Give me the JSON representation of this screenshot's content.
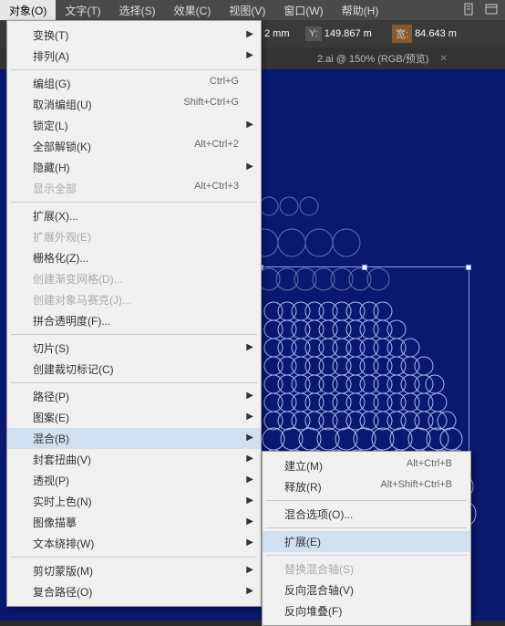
{
  "menubar": {
    "items": [
      "对象(O)",
      "文字(T)",
      "选择(S)",
      "效果(C)",
      "视图(V)",
      "窗口(W)",
      "帮助(H)"
    ],
    "active_index": 0
  },
  "propbar": {
    "unit1": "2 mm",
    "y_label": "Y:",
    "y_value": "149.867 m",
    "w_label": "宽:",
    "w_value": "84.643 m"
  },
  "tabbar": {
    "tabs": [
      {
        "label": ""
      },
      {
        "label": "2.ai @ 150% (RGB/预览)"
      }
    ]
  },
  "object_menu": [
    {
      "label": "变换(T)",
      "sub": true
    },
    {
      "label": "排列(A)",
      "sub": true
    },
    {
      "sep": true
    },
    {
      "label": "编组(G)",
      "shortcut": "Ctrl+G"
    },
    {
      "label": "取消编组(U)",
      "shortcut": "Shift+Ctrl+G"
    },
    {
      "label": "锁定(L)",
      "sub": true
    },
    {
      "label": "全部解锁(K)",
      "shortcut": "Alt+Ctrl+2"
    },
    {
      "label": "隐藏(H)",
      "sub": true
    },
    {
      "label": "显示全部",
      "shortcut": "Alt+Ctrl+3",
      "disabled": true
    },
    {
      "sep": true
    },
    {
      "label": "扩展(X)..."
    },
    {
      "label": "扩展外观(E)",
      "disabled": true
    },
    {
      "label": "栅格化(Z)..."
    },
    {
      "label": "创建渐变网格(D)...",
      "disabled": true
    },
    {
      "label": "创建对象马赛克(J)...",
      "disabled": true
    },
    {
      "label": "拼合透明度(F)..."
    },
    {
      "sep": true
    },
    {
      "label": "切片(S)",
      "sub": true
    },
    {
      "label": "创建裁切标记(C)"
    },
    {
      "sep": true
    },
    {
      "label": "路径(P)",
      "sub": true
    },
    {
      "label": "图案(E)",
      "sub": true
    },
    {
      "label": "混合(B)",
      "sub": true,
      "highlighted": true
    },
    {
      "label": "封套扭曲(V)",
      "sub": true
    },
    {
      "label": "透视(P)",
      "sub": true
    },
    {
      "label": "实时上色(N)",
      "sub": true
    },
    {
      "label": "图像描摹",
      "sub": true
    },
    {
      "label": "文本绕排(W)",
      "sub": true
    },
    {
      "sep": true
    },
    {
      "label": "剪切蒙版(M)",
      "sub": true
    },
    {
      "label": "复合路径(O)",
      "sub": true
    }
  ],
  "blend_submenu": [
    {
      "label": "建立(M)",
      "shortcut": "Alt+Ctrl+B"
    },
    {
      "label": "释放(R)",
      "shortcut": "Alt+Shift+Ctrl+B"
    },
    {
      "sep": true
    },
    {
      "label": "混合选项(O)..."
    },
    {
      "sep": true
    },
    {
      "label": "扩展(E)",
      "highlighted": true
    },
    {
      "sep": true
    },
    {
      "label": "替换混合轴(S)",
      "disabled": true
    },
    {
      "label": "反向混合轴(V)"
    },
    {
      "label": "反向堆叠(F)"
    }
  ]
}
